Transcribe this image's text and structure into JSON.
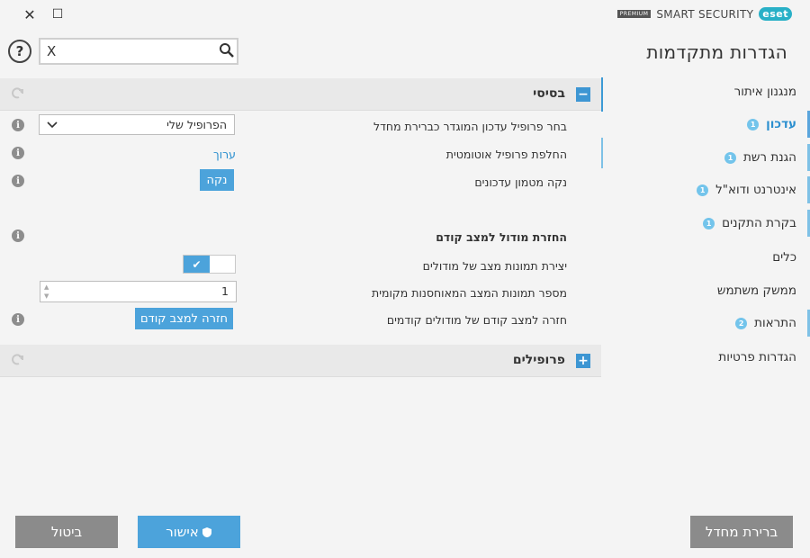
{
  "window": {
    "close_glyph": "✕",
    "maximize_glyph": "☐"
  },
  "brand": {
    "logo": "eset",
    "product": "SMART SECURITY",
    "edition": "PREMIUM"
  },
  "sidebar": {
    "title": "הגדרות מתקדמות",
    "items": [
      {
        "label": "מנגנון איתור",
        "badge": ""
      },
      {
        "label": "עדכון",
        "badge": "1"
      },
      {
        "label": "הגנת רשת",
        "badge": "1"
      },
      {
        "label": "אינטרנט ודוא\"ל",
        "badge": "1"
      },
      {
        "label": "בקרת התקנים",
        "badge": "1"
      },
      {
        "label": "כלים",
        "badge": ""
      },
      {
        "label": "ממשק משתמש",
        "badge": ""
      },
      {
        "label": "התראות",
        "badge": "2"
      },
      {
        "label": "הגדרות פרטיות",
        "badge": ""
      }
    ]
  },
  "search": {
    "value": "",
    "clear_glyph": "X",
    "help_glyph": "?"
  },
  "sections": {
    "basic": {
      "title": "בסיסי",
      "toggle": "−"
    },
    "profiles": {
      "title": "פרופילים",
      "toggle": "+"
    }
  },
  "basic": {
    "profile_label": "בחר פרופיל עדכון המוגדר כברירת מחדל",
    "profile_value": "הפרופיל שלי",
    "auto_switch_label": "החלפת פרופיל אוטומטית",
    "auto_switch_link": "ערוך",
    "clear_cache_label": "נקה מטמון עדכונים",
    "clear_cache_button": "נקה"
  },
  "rollback": {
    "heading": "החזרת מודול למצב קודם",
    "snapshots_label": "יצירת תמונות מצב של מודולים",
    "snapshots_enabled": true,
    "count_label": "מספר תמונות המצב המאוחסנות מקומית",
    "count_value": "1",
    "revert_label": "חזרה למצב קודם של מודולים קודמים",
    "revert_button": "חזרה למצב קודם"
  },
  "footer": {
    "default_button": "ברירת מחדל",
    "ok_button": "אישור",
    "cancel_button": "ביטול"
  },
  "colors": {
    "accent": "#4ca3db",
    "badge": "#73c4eb",
    "gray_button": "#8b8b8b"
  }
}
